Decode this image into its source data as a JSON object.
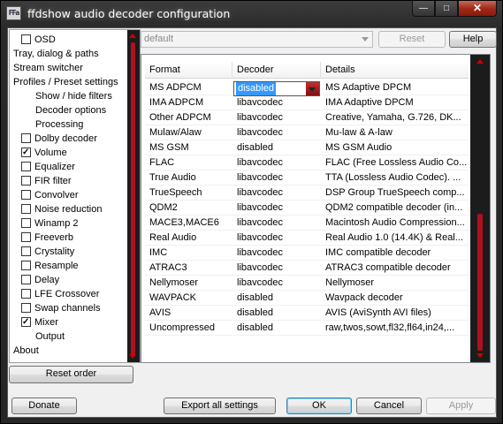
{
  "window": {
    "title": "ffdshow audio decoder configuration",
    "icon_text": "FFa",
    "buttons": {
      "minimize": "—",
      "maximize": "□",
      "close": "✕"
    }
  },
  "sidebar": {
    "items": [
      {
        "label": "OSD",
        "checkbox": true,
        "checked": false,
        "indent": 1
      },
      {
        "label": "Tray, dialog & paths",
        "checkbox": false,
        "indent": 0
      },
      {
        "label": "Stream switcher",
        "checkbox": false,
        "indent": 0
      },
      {
        "label": "Profiles / Preset settings",
        "checkbox": false,
        "indent": 0
      },
      {
        "label": "Show / hide filters",
        "checkbox": false,
        "indent": 2
      },
      {
        "label": "Decoder options",
        "checkbox": false,
        "indent": 2
      },
      {
        "label": "Processing",
        "checkbox": false,
        "indent": 2
      },
      {
        "label": "Dolby decoder",
        "checkbox": true,
        "checked": false,
        "indent": 1
      },
      {
        "label": "Volume",
        "checkbox": true,
        "checked": true,
        "indent": 1
      },
      {
        "label": "Equalizer",
        "checkbox": true,
        "checked": false,
        "indent": 1
      },
      {
        "label": "FIR filter",
        "checkbox": true,
        "checked": false,
        "indent": 1
      },
      {
        "label": "Convolver",
        "checkbox": true,
        "checked": false,
        "indent": 1
      },
      {
        "label": "Noise reduction",
        "checkbox": true,
        "checked": false,
        "indent": 1
      },
      {
        "label": "Winamp 2",
        "checkbox": true,
        "checked": false,
        "indent": 1
      },
      {
        "label": "Freeverb",
        "checkbox": true,
        "checked": false,
        "indent": 1
      },
      {
        "label": "Crystality",
        "checkbox": true,
        "checked": false,
        "indent": 1
      },
      {
        "label": "Resample",
        "checkbox": true,
        "checked": false,
        "indent": 1
      },
      {
        "label": "Delay",
        "checkbox": true,
        "checked": false,
        "indent": 1
      },
      {
        "label": "LFE Crossover",
        "checkbox": true,
        "checked": false,
        "indent": 1
      },
      {
        "label": "Swap channels",
        "checkbox": true,
        "checked": false,
        "indent": 1
      },
      {
        "label": "Mixer",
        "checkbox": true,
        "checked": true,
        "indent": 1
      },
      {
        "label": "Output",
        "checkbox": false,
        "indent": 2
      },
      {
        "label": "About",
        "checkbox": false,
        "indent": 0
      }
    ],
    "reset_order_label": "Reset order"
  },
  "preset": {
    "value": "default",
    "reset_label": "Reset",
    "help_label": "Help"
  },
  "table": {
    "columns": [
      "Format",
      "Decoder",
      "Details"
    ],
    "rows": [
      {
        "format": "MS ADPCM",
        "decoder": "disabled",
        "details": "MS Adaptive DPCM",
        "editing": true
      },
      {
        "format": "IMA ADPCM",
        "decoder": "libavcodec",
        "details": "IMA Adaptive DPCM"
      },
      {
        "format": "Other ADPCM",
        "decoder": "libavcodec",
        "details": "Creative, Yamaha, G.726, DK..."
      },
      {
        "format": "Mulaw/Alaw",
        "decoder": "libavcodec",
        "details": "Mu-law & A-law"
      },
      {
        "format": "MS GSM",
        "decoder": "disabled",
        "details": "MS GSM Audio"
      },
      {
        "format": "FLAC",
        "decoder": "libavcodec",
        "details": "FLAC (Free Lossless Audio Co..."
      },
      {
        "format": "True Audio",
        "decoder": "libavcodec",
        "details": "TTA (Lossless Audio Codec). ..."
      },
      {
        "format": "TrueSpeech",
        "decoder": "libavcodec",
        "details": "DSP Group TrueSpeech comp..."
      },
      {
        "format": "QDM2",
        "decoder": "libavcodec",
        "details": "QDM2 compatible decoder (in..."
      },
      {
        "format": "MACE3,MACE6",
        "decoder": "libavcodec",
        "details": "Macintosh Audio Compression..."
      },
      {
        "format": "Real Audio",
        "decoder": "libavcodec",
        "details": "Real Audio 1.0 (14.4K) & Real..."
      },
      {
        "format": "IMC",
        "decoder": "libavcodec",
        "details": "IMC compatible decoder"
      },
      {
        "format": "ATRAC3",
        "decoder": "libavcodec",
        "details": "ATRAC3 compatible decoder"
      },
      {
        "format": "Nellymoser",
        "decoder": "libavcodec",
        "details": "Nellymoser"
      },
      {
        "format": "WAVPACK",
        "decoder": "disabled",
        "details": "Wavpack decoder"
      },
      {
        "format": "AVIS",
        "decoder": "disabled",
        "details": "AVIS (AviSynth AVI files)"
      },
      {
        "format": "Uncompressed",
        "decoder": "disabled",
        "details": "raw,twos,sowt,fl32,fl64,in24,..."
      }
    ]
  },
  "footer": {
    "donate": "Donate",
    "export": "Export all settings",
    "ok": "OK",
    "cancel": "Cancel",
    "apply": "Apply"
  },
  "colors": {
    "accent_red": "#b01020",
    "selection": "#3399ff",
    "frame": "#2a2a2a"
  }
}
